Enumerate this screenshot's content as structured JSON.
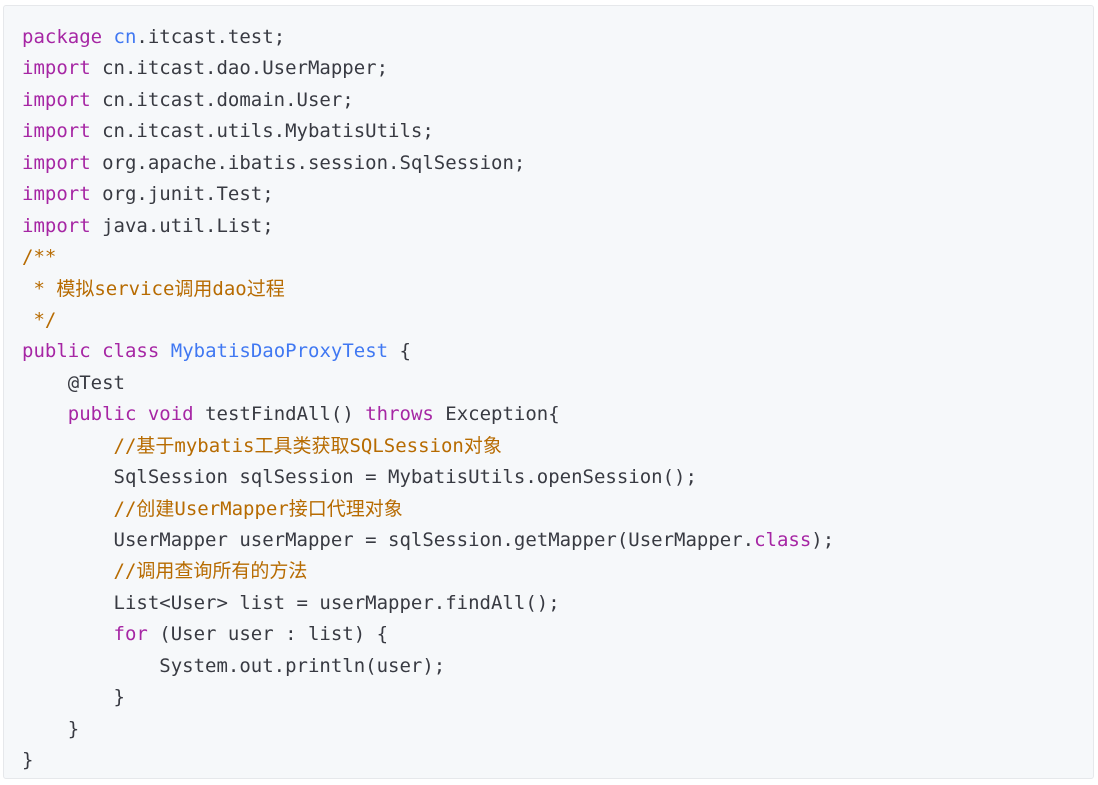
{
  "code": {
    "lines": [
      [
        {
          "t": "package",
          "c": "kw"
        },
        {
          "t": " "
        },
        {
          "t": "cn",
          "c": "cls"
        },
        {
          "t": ".itcast.test;"
        }
      ],
      [
        {
          "t": "import",
          "c": "kw"
        },
        {
          "t": " cn.itcast.dao.UserMapper;"
        }
      ],
      [
        {
          "t": "import",
          "c": "kw"
        },
        {
          "t": " cn.itcast.domain.User;"
        }
      ],
      [
        {
          "t": "import",
          "c": "kw"
        },
        {
          "t": " cn.itcast.utils.MybatisUtils;"
        }
      ],
      [
        {
          "t": "import",
          "c": "kw"
        },
        {
          "t": " org.apache.ibatis.session.SqlSession;"
        }
      ],
      [
        {
          "t": "import",
          "c": "kw"
        },
        {
          "t": " org.junit.Test;"
        }
      ],
      [
        {
          "t": "import",
          "c": "kw"
        },
        {
          "t": " java.util.List;"
        }
      ],
      [
        {
          "t": "/**",
          "c": "cm"
        }
      ],
      [
        {
          "t": " * 模拟service调用dao过程",
          "c": "cm"
        }
      ],
      [
        {
          "t": " */",
          "c": "cm"
        }
      ],
      [
        {
          "t": "public",
          "c": "kw"
        },
        {
          "t": " "
        },
        {
          "t": "class",
          "c": "kw"
        },
        {
          "t": " "
        },
        {
          "t": "MybatisDaoProxyTest",
          "c": "cls"
        },
        {
          "t": " {"
        }
      ],
      [
        {
          "t": "    @Test"
        }
      ],
      [
        {
          "t": "    "
        },
        {
          "t": "public",
          "c": "kw"
        },
        {
          "t": " "
        },
        {
          "t": "void",
          "c": "kw"
        },
        {
          "t": " testFindAll() "
        },
        {
          "t": "throws",
          "c": "kw"
        },
        {
          "t": " Exception{"
        }
      ],
      [
        {
          "t": "        "
        },
        {
          "t": "//基于mybatis工具类获取SQLSession对象",
          "c": "cm"
        }
      ],
      [
        {
          "t": "        SqlSession sqlSession = MybatisUtils.openSession();"
        }
      ],
      [
        {
          "t": "        "
        },
        {
          "t": "//创建UserMapper接口代理对象",
          "c": "cm"
        }
      ],
      [
        {
          "t": "        UserMapper userMapper = sqlSession.getMapper(UserMapper."
        },
        {
          "t": "class",
          "c": "kw"
        },
        {
          "t": ");"
        }
      ],
      [
        {
          "t": "        "
        },
        {
          "t": "//调用查询所有的方法",
          "c": "cm"
        }
      ],
      [
        {
          "t": "        List<User> list = userMapper.findAll();"
        }
      ],
      [
        {
          "t": "        "
        },
        {
          "t": "for",
          "c": "kw"
        },
        {
          "t": " (User user : list) {"
        }
      ],
      [
        {
          "t": "            System.out.println(user);"
        }
      ],
      [
        {
          "t": "        }"
        }
      ],
      [
        {
          "t": "    }"
        }
      ],
      [
        {
          "t": "}"
        }
      ]
    ]
  }
}
